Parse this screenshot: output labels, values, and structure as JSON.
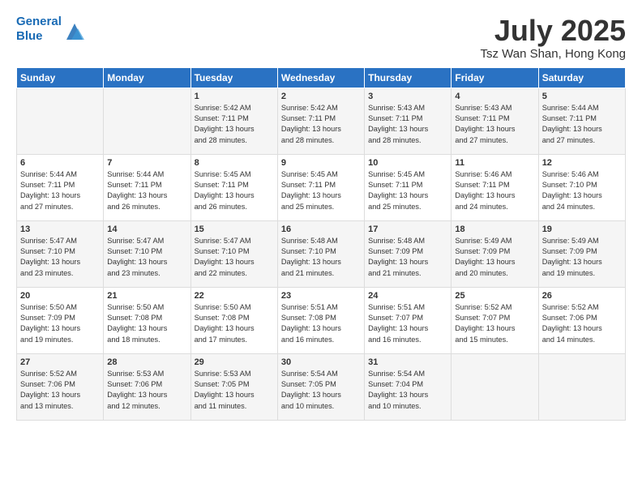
{
  "header": {
    "logo_line1": "General",
    "logo_line2": "Blue",
    "month": "July 2025",
    "location": "Tsz Wan Shan, Hong Kong"
  },
  "weekdays": [
    "Sunday",
    "Monday",
    "Tuesday",
    "Wednesday",
    "Thursday",
    "Friday",
    "Saturday"
  ],
  "weeks": [
    [
      {
        "day": "",
        "info": ""
      },
      {
        "day": "",
        "info": ""
      },
      {
        "day": "1",
        "info": "Sunrise: 5:42 AM\nSunset: 7:11 PM\nDaylight: 13 hours\nand 28 minutes."
      },
      {
        "day": "2",
        "info": "Sunrise: 5:42 AM\nSunset: 7:11 PM\nDaylight: 13 hours\nand 28 minutes."
      },
      {
        "day": "3",
        "info": "Sunrise: 5:43 AM\nSunset: 7:11 PM\nDaylight: 13 hours\nand 28 minutes."
      },
      {
        "day": "4",
        "info": "Sunrise: 5:43 AM\nSunset: 7:11 PM\nDaylight: 13 hours\nand 27 minutes."
      },
      {
        "day": "5",
        "info": "Sunrise: 5:44 AM\nSunset: 7:11 PM\nDaylight: 13 hours\nand 27 minutes."
      }
    ],
    [
      {
        "day": "6",
        "info": "Sunrise: 5:44 AM\nSunset: 7:11 PM\nDaylight: 13 hours\nand 27 minutes."
      },
      {
        "day": "7",
        "info": "Sunrise: 5:44 AM\nSunset: 7:11 PM\nDaylight: 13 hours\nand 26 minutes."
      },
      {
        "day": "8",
        "info": "Sunrise: 5:45 AM\nSunset: 7:11 PM\nDaylight: 13 hours\nand 26 minutes."
      },
      {
        "day": "9",
        "info": "Sunrise: 5:45 AM\nSunset: 7:11 PM\nDaylight: 13 hours\nand 25 minutes."
      },
      {
        "day": "10",
        "info": "Sunrise: 5:45 AM\nSunset: 7:11 PM\nDaylight: 13 hours\nand 25 minutes."
      },
      {
        "day": "11",
        "info": "Sunrise: 5:46 AM\nSunset: 7:11 PM\nDaylight: 13 hours\nand 24 minutes."
      },
      {
        "day": "12",
        "info": "Sunrise: 5:46 AM\nSunset: 7:10 PM\nDaylight: 13 hours\nand 24 minutes."
      }
    ],
    [
      {
        "day": "13",
        "info": "Sunrise: 5:47 AM\nSunset: 7:10 PM\nDaylight: 13 hours\nand 23 minutes."
      },
      {
        "day": "14",
        "info": "Sunrise: 5:47 AM\nSunset: 7:10 PM\nDaylight: 13 hours\nand 23 minutes."
      },
      {
        "day": "15",
        "info": "Sunrise: 5:47 AM\nSunset: 7:10 PM\nDaylight: 13 hours\nand 22 minutes."
      },
      {
        "day": "16",
        "info": "Sunrise: 5:48 AM\nSunset: 7:10 PM\nDaylight: 13 hours\nand 21 minutes."
      },
      {
        "day": "17",
        "info": "Sunrise: 5:48 AM\nSunset: 7:09 PM\nDaylight: 13 hours\nand 21 minutes."
      },
      {
        "day": "18",
        "info": "Sunrise: 5:49 AM\nSunset: 7:09 PM\nDaylight: 13 hours\nand 20 minutes."
      },
      {
        "day": "19",
        "info": "Sunrise: 5:49 AM\nSunset: 7:09 PM\nDaylight: 13 hours\nand 19 minutes."
      }
    ],
    [
      {
        "day": "20",
        "info": "Sunrise: 5:50 AM\nSunset: 7:09 PM\nDaylight: 13 hours\nand 19 minutes."
      },
      {
        "day": "21",
        "info": "Sunrise: 5:50 AM\nSunset: 7:08 PM\nDaylight: 13 hours\nand 18 minutes."
      },
      {
        "day": "22",
        "info": "Sunrise: 5:50 AM\nSunset: 7:08 PM\nDaylight: 13 hours\nand 17 minutes."
      },
      {
        "day": "23",
        "info": "Sunrise: 5:51 AM\nSunset: 7:08 PM\nDaylight: 13 hours\nand 16 minutes."
      },
      {
        "day": "24",
        "info": "Sunrise: 5:51 AM\nSunset: 7:07 PM\nDaylight: 13 hours\nand 16 minutes."
      },
      {
        "day": "25",
        "info": "Sunrise: 5:52 AM\nSunset: 7:07 PM\nDaylight: 13 hours\nand 15 minutes."
      },
      {
        "day": "26",
        "info": "Sunrise: 5:52 AM\nSunset: 7:06 PM\nDaylight: 13 hours\nand 14 minutes."
      }
    ],
    [
      {
        "day": "27",
        "info": "Sunrise: 5:52 AM\nSunset: 7:06 PM\nDaylight: 13 hours\nand 13 minutes."
      },
      {
        "day": "28",
        "info": "Sunrise: 5:53 AM\nSunset: 7:06 PM\nDaylight: 13 hours\nand 12 minutes."
      },
      {
        "day": "29",
        "info": "Sunrise: 5:53 AM\nSunset: 7:05 PM\nDaylight: 13 hours\nand 11 minutes."
      },
      {
        "day": "30",
        "info": "Sunrise: 5:54 AM\nSunset: 7:05 PM\nDaylight: 13 hours\nand 10 minutes."
      },
      {
        "day": "31",
        "info": "Sunrise: 5:54 AM\nSunset: 7:04 PM\nDaylight: 13 hours\nand 10 minutes."
      },
      {
        "day": "",
        "info": ""
      },
      {
        "day": "",
        "info": ""
      }
    ]
  ]
}
